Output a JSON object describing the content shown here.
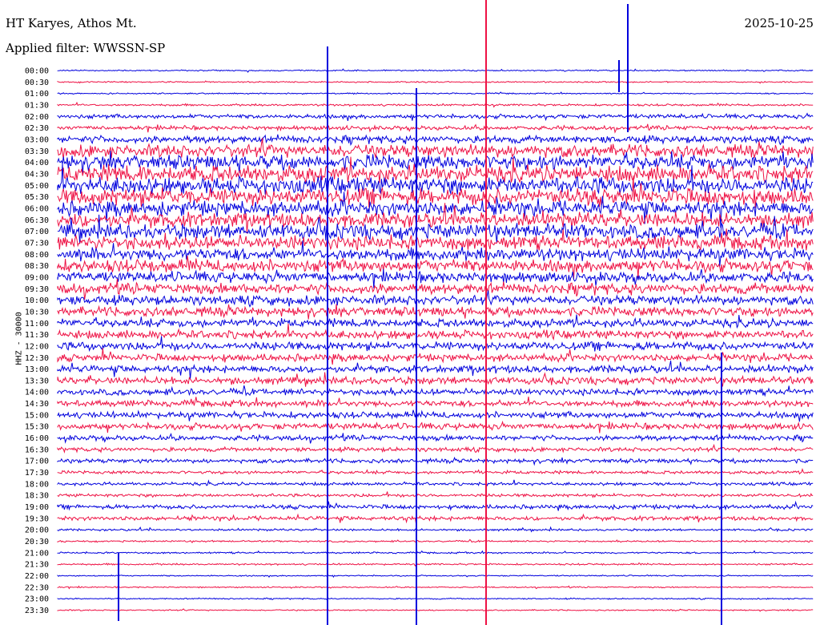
{
  "header": {
    "station": "HT Karyes, Athos Mt.",
    "filter": "Applied filter: WWSSN-SP",
    "date": "2025-10-25"
  },
  "chart_data": {
    "type": "line",
    "title": "HT Karyes, Athos Mt.",
    "ylabel": "HHZ - 30000",
    "row_labels": [
      "00:00",
      "00:30",
      "01:00",
      "01:30",
      "02:00",
      "02:30",
      "03:00",
      "03:30",
      "04:00",
      "04:30",
      "05:00",
      "05:30",
      "06:00",
      "06:30",
      "07:00",
      "07:30",
      "08:00",
      "08:30",
      "09:00",
      "09:30",
      "10:00",
      "10:30",
      "11:00",
      "11:30",
      "12:00",
      "12:30",
      "13:00",
      "13:30",
      "14:00",
      "14:30",
      "15:00",
      "15:30",
      "16:00",
      "16:30",
      "17:00",
      "17:30",
      "18:00",
      "18:30",
      "19:00",
      "19:30",
      "20:00",
      "20:30",
      "21:00",
      "21:30",
      "22:00",
      "22:30",
      "23:00",
      "23:30"
    ],
    "row_noise_level": [
      0.06,
      0.06,
      0.06,
      0.1,
      0.2,
      0.2,
      0.35,
      0.6,
      0.7,
      0.8,
      0.8,
      0.8,
      0.7,
      0.7,
      0.7,
      0.65,
      0.6,
      0.6,
      0.5,
      0.5,
      0.45,
      0.45,
      0.4,
      0.4,
      0.4,
      0.35,
      0.35,
      0.35,
      0.3,
      0.3,
      0.3,
      0.3,
      0.25,
      0.2,
      0.2,
      0.15,
      0.15,
      0.15,
      0.2,
      0.2,
      0.1,
      0.08,
      0.08,
      0.08,
      0.06,
      0.06,
      0.06,
      0.06
    ],
    "colors": {
      "even_rows": "#0000dd",
      "odd_rows": "#ee1144"
    }
  }
}
